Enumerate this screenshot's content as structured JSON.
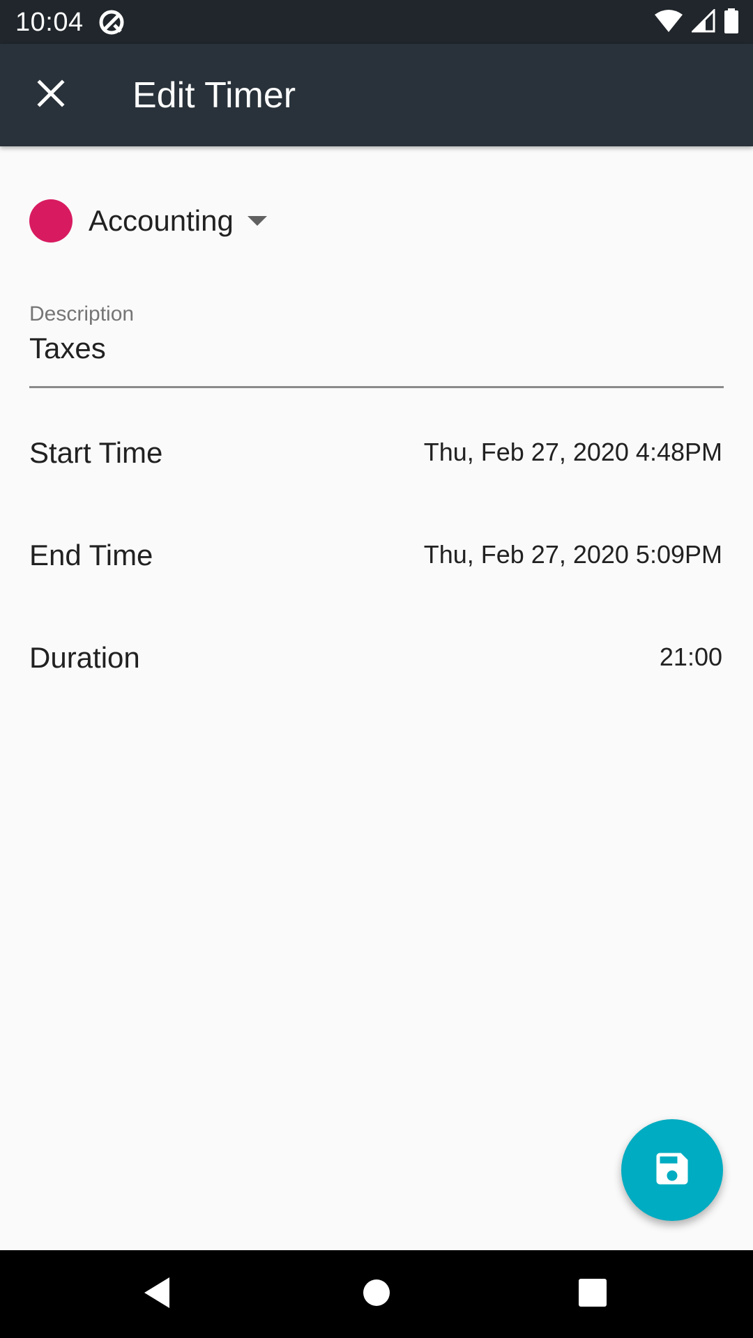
{
  "status_bar": {
    "time": "10:04",
    "icons": [
      "app-notification-icon",
      "wifi-icon",
      "cellular-signal-icon",
      "battery-icon"
    ]
  },
  "app_bar": {
    "title": "Edit Timer",
    "close_icon": "close-icon"
  },
  "category": {
    "name": "Accounting",
    "color": "#d81b60",
    "dropdown_icon": "dropdown-caret-icon"
  },
  "description": {
    "label": "Description",
    "value": "Taxes"
  },
  "start_time": {
    "label": "Start Time",
    "value": "Thu, Feb 27, 2020 4:48PM"
  },
  "end_time": {
    "label": "End Time",
    "value": "Thu, Feb 27, 2020 5:09PM"
  },
  "duration": {
    "label": "Duration",
    "value": "21:00"
  },
  "fab": {
    "icon": "save-icon",
    "color": "#00acc1"
  },
  "nav_bar": {
    "buttons": [
      "back-icon",
      "home-icon",
      "recents-icon"
    ]
  },
  "colors": {
    "status_bar": "#20262b",
    "app_bar": "#29323a",
    "background": "#fafafa"
  }
}
